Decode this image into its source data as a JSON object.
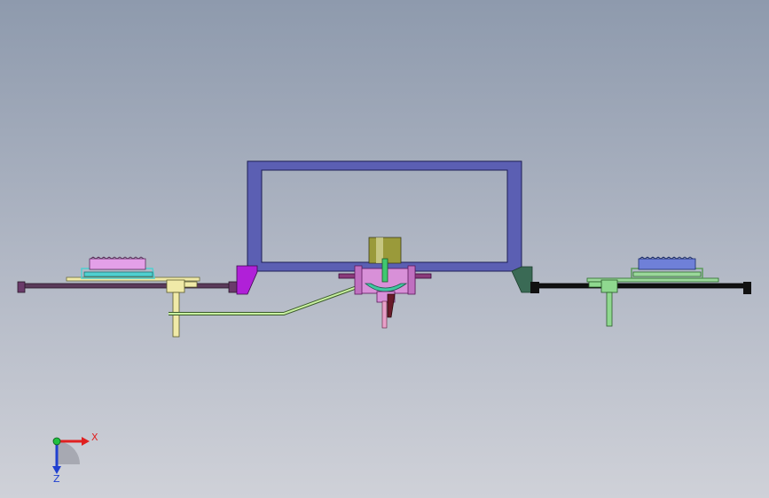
{
  "viewport": {
    "background_top": "#8e9aad",
    "background_bottom": "#cfd1d8"
  },
  "axes": {
    "x_label": "X",
    "z_label": "Z",
    "x_color": "#e02020",
    "z_color": "#2040d0",
    "origin_color": "#20c040"
  },
  "colors": {
    "frame": "#5b5fb3",
    "frame_outline": "#1c1e55",
    "left_bracket": "#b020d8",
    "right_bracket": "#3a6a55",
    "left_arm": "#5a3a5a",
    "right_arm": "#111111",
    "left_hub": "#f0eaa8",
    "right_hub": "#8fd88f",
    "left_pad": "#e4a0e8",
    "right_pad": "#6f80d8",
    "left_tray": "#4fd0d0",
    "right_tray": "#9bd89b",
    "center_motor": "#9a9a3a",
    "center_mount": "#d890d8",
    "center_lens": "#40c8a0",
    "center_rod": "#6a1a2a",
    "linkage": "#c8f0a0"
  }
}
